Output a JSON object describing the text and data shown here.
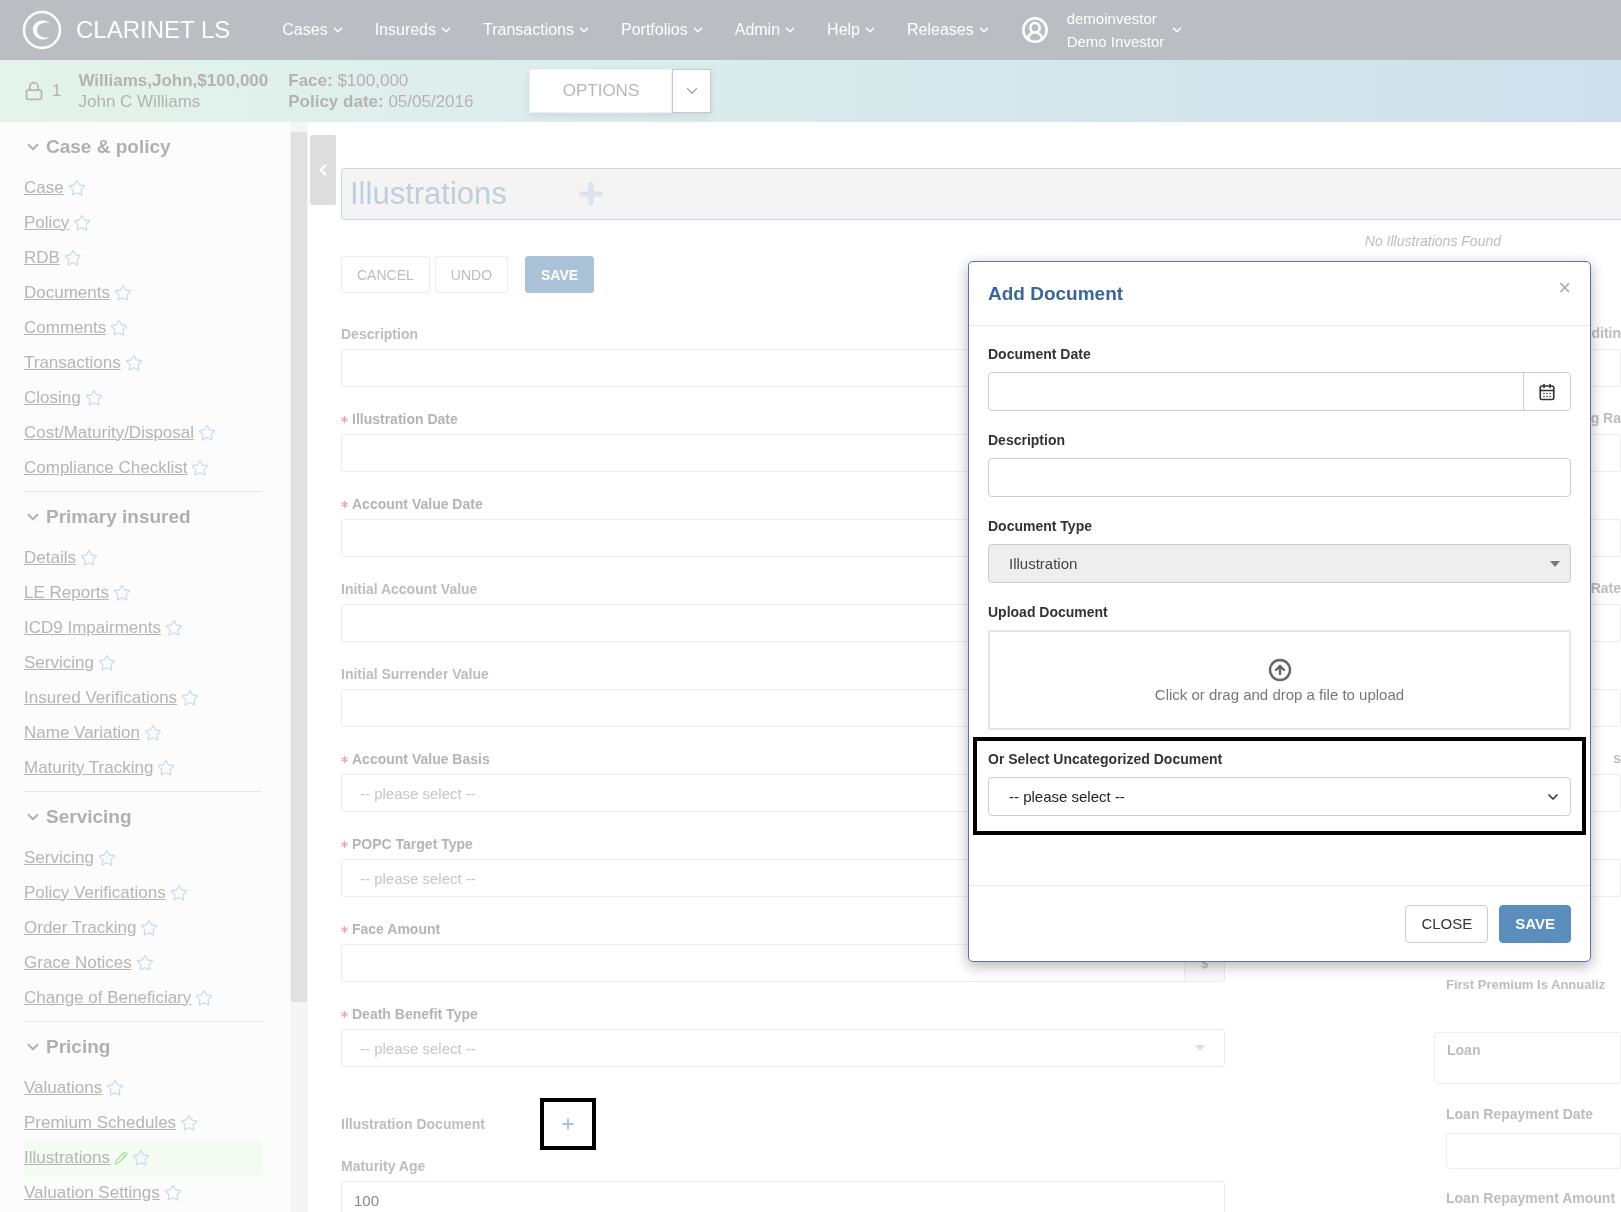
{
  "top_bar": {
    "logo_text": "CLARINET LS",
    "menu": [
      {
        "label": "Cases"
      },
      {
        "label": "Insureds"
      },
      {
        "label": "Transactions"
      },
      {
        "label": "Portfolios"
      },
      {
        "label": "Admin"
      },
      {
        "label": "Help"
      },
      {
        "label": "Releases"
      }
    ],
    "user": {
      "username": "demoinvestor",
      "name": "Demo Investor"
    }
  },
  "case_bar": {
    "count": "1",
    "case_title": "Williams,John,$100,000",
    "insured_name": "John C Williams",
    "face": "**Face:** $100,000",
    "policy_date": "**Policy date:** 05/05/2016",
    "options_button": "OPTIONS"
  },
  "sidebar": {
    "sections": [
      {
        "title": "Case & policy",
        "expanded": true,
        "items": [
          {
            "label": "Case",
            "selected": false
          },
          {
            "label": "Policy",
            "selected": false
          },
          {
            "label": "RDB",
            "selected": false
          },
          {
            "label": "Documents",
            "selected": false
          },
          {
            "label": "Comments",
            "selected": false
          },
          {
            "label": "Transactions",
            "selected": false
          },
          {
            "label": "Closing",
            "selected": false
          },
          {
            "label": "Cost/Maturity/Disposal",
            "selected": false
          },
          {
            "label": "Compliance Checklist",
            "selected": false
          }
        ]
      },
      {
        "title": "Primary insured",
        "expanded": true,
        "items": [
          {
            "label": "Details",
            "selected": false
          },
          {
            "label": "LE Reports",
            "selected": false
          },
          {
            "label": "ICD9 Impairments",
            "selected": false
          },
          {
            "label": "Servicing",
            "selected": false
          },
          {
            "label": "Insured Verifications",
            "selected": false
          },
          {
            "label": "Name Variation",
            "selected": false
          },
          {
            "label": "Maturity Tracking",
            "selected": false
          }
        ]
      },
      {
        "title": "Servicing",
        "expanded": true,
        "items": [
          {
            "label": "Servicing",
            "selected": false
          },
          {
            "label": "Policy Verifications",
            "selected": false
          },
          {
            "label": "Order Tracking",
            "selected": false
          },
          {
            "label": "Grace Notices",
            "selected": false
          },
          {
            "label": "Change of Beneficiary",
            "selected": false
          }
        ]
      },
      {
        "title": "Pricing",
        "expanded": true,
        "items": [
          {
            "label": "Valuations",
            "selected": false
          },
          {
            "label": "Premium Schedules",
            "selected": false
          },
          {
            "label": "Illustrations",
            "selected": true
          },
          {
            "label": "Valuation Settings",
            "selected": false
          }
        ]
      }
    ]
  },
  "page": {
    "title": "Illustrations",
    "empty_message": "No Illustrations Found",
    "buttons": [
      {
        "label": "CANCEL",
        "kind": "default"
      },
      {
        "label": "UNDO",
        "kind": "default"
      },
      {
        "label": "SAVE",
        "kind": "primary"
      }
    ],
    "form": [
      {
        "label": "Description",
        "required": false,
        "kind": "input"
      },
      {
        "label": "Illustration Date",
        "required": true,
        "kind": "input"
      },
      {
        "label": "Account Value Date",
        "required": true,
        "kind": "input"
      },
      {
        "label": "Initial Account Value",
        "required": false,
        "kind": "input"
      },
      {
        "label": "Initial Surrender Value",
        "required": false,
        "kind": "input"
      },
      {
        "label": "Account Value Basis",
        "required": true,
        "kind": "select",
        "placeholder": "-- please select --"
      },
      {
        "label": "POPC Target Type",
        "required": true,
        "kind": "select",
        "placeholder": "-- please select --"
      },
      {
        "label": "Face Amount",
        "required": true,
        "kind": "money",
        "addon": "$"
      },
      {
        "label": "Death Benefit Type",
        "required": true,
        "kind": "select",
        "placeholder": "-- please select --"
      },
      {
        "label": "Illustration Document",
        "required": false,
        "kind": "upload",
        "highlighted": true
      },
      {
        "label": "Maturity Age",
        "required": false,
        "kind": "input",
        "value": "100"
      }
    ],
    "side_fields": [
      {
        "kind": "partial",
        "label": "ditin"
      },
      {
        "kind": "partial",
        "label": "g Ra"
      },
      {
        "kind": "partial"
      },
      {
        "kind": "partial",
        "label": "Rate"
      },
      {
        "kind": "partial"
      },
      {
        "kind": "partial",
        "label": "s"
      },
      {
        "kind": "partial"
      },
      {
        "kind": "caption",
        "label": "First Premium Is Annualiz"
      },
      {
        "kind": "boxed",
        "label": "Loan"
      },
      {
        "kind": "field",
        "label": "Loan Repayment Date"
      },
      {
        "kind": "field",
        "label": "Loan Repayment Amount"
      }
    ]
  },
  "modal": {
    "title": "Add Document",
    "close_glyph": "×",
    "fields": [
      {
        "label": "Document Date",
        "kind": "date"
      },
      {
        "label": "Description",
        "kind": "input"
      },
      {
        "label": "Document Type",
        "kind": "select",
        "value": "Illustration",
        "disabled": true
      },
      {
        "label": "Upload Document",
        "kind": "dropzone",
        "hint": "Click or drag and drop a file to upload"
      },
      {
        "label": "Or Select Uncategorized Document",
        "kind": "select",
        "value": "-- please select --",
        "disabled": false,
        "highlighted": true
      }
    ],
    "buttons": [
      {
        "label": "CLOSE",
        "kind": "default"
      },
      {
        "label": "SAVE",
        "kind": "primary"
      }
    ]
  }
}
